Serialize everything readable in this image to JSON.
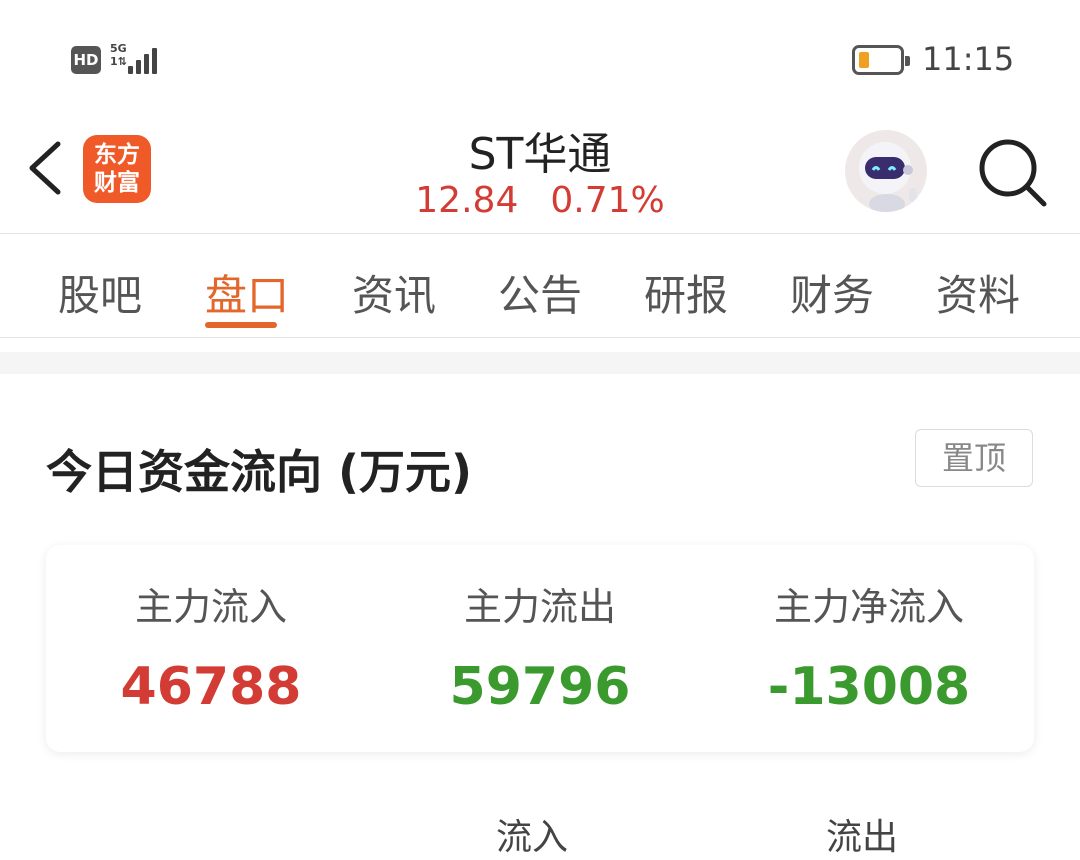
{
  "status_bar": {
    "hd": "HD",
    "network": "5G",
    "network_sub": "1⇅",
    "time": "11:15"
  },
  "header": {
    "logo_line1": "东方",
    "logo_line2": "财富",
    "stock_name": "ST华通",
    "price": "12.84",
    "change_pct": "0.71%"
  },
  "tabs": [
    {
      "label": "股吧"
    },
    {
      "label": "盘口"
    },
    {
      "label": "资讯"
    },
    {
      "label": "公告"
    },
    {
      "label": "研报"
    },
    {
      "label": "财务"
    },
    {
      "label": "资料"
    }
  ],
  "active_tab": "盘口",
  "fund_flow": {
    "title": "今日资金流向 (万元)",
    "pin_label": "置顶",
    "columns": [
      {
        "label": "主力流入",
        "value": "46788",
        "color": "red"
      },
      {
        "label": "主力流出",
        "value": "59796",
        "color": "green"
      },
      {
        "label": "主力净流入",
        "value": "-13008",
        "color": "green"
      }
    ],
    "table_headers": [
      "流入",
      "流出"
    ]
  },
  "colors": {
    "accent": "#e3662b",
    "up": "#d23c34",
    "down": "#3b9a2e",
    "logo": "#f05a28"
  }
}
